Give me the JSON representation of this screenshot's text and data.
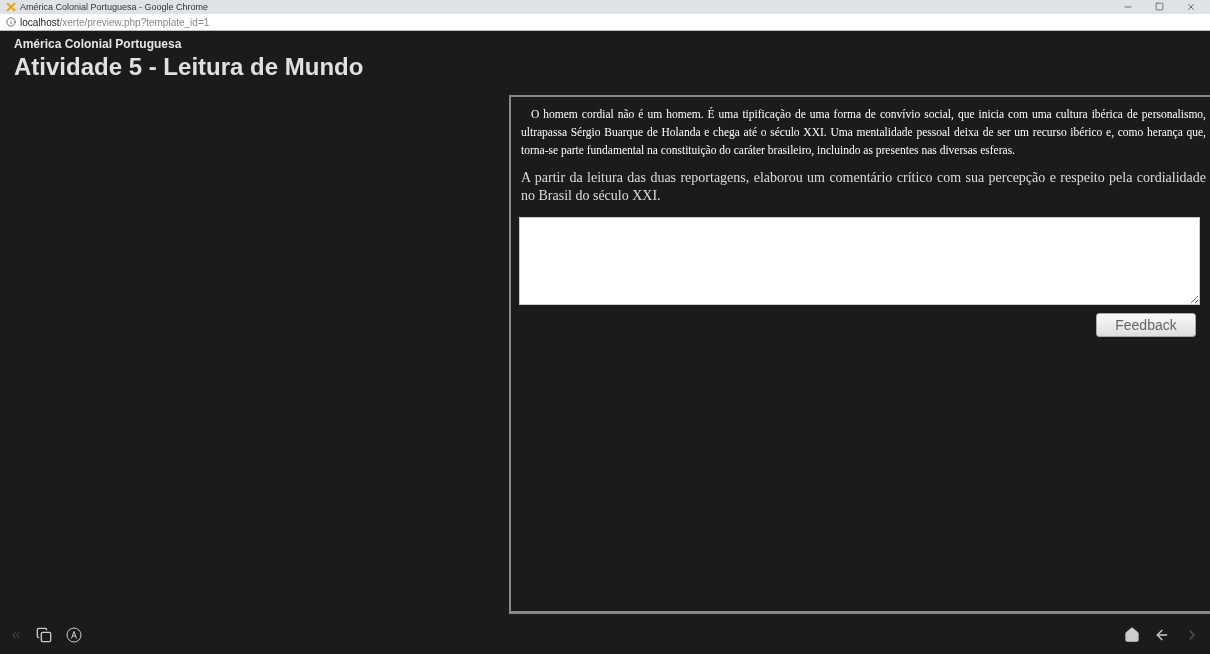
{
  "window": {
    "title": "América Colonial Portuguesa - Google Chrome"
  },
  "address_bar": {
    "host": "localhost",
    "path": "/xerte/preview.php?template_id=1"
  },
  "header": {
    "subtitle": "América Colonial Portuguesa",
    "title": "Atividade 5 - Leitura de Mundo"
  },
  "content": {
    "intro": "O homem cordial não é um homem. É uma tipificação de uma forma de convívio social, que inicia com uma cultura ibérica de personalismo, ultrapassa Sérgio Buarque de Holanda e chega até o século XXI. Uma mentalidade pessoal deixa de ser um recurso ibérico e, como herança que, torna-se parte fundamental na constituição do caráter brasileiro, incluindo as presentes nas diversas esferas.",
    "question": "A partir da leitura das duas reportagens, elaborou um comentário crítico com sua percepção e respeito pela cordialidade no Brasil do século XXI.",
    "button": "Feedback"
  },
  "footer": {
    "left": [
      {
        "kind": "collapse",
        "disabled": true
      },
      {
        "kind": "glossary",
        "disabled": false
      },
      {
        "kind": "accessibility",
        "disabled": false
      }
    ],
    "right": [
      {
        "kind": "home",
        "disabled": false
      },
      {
        "kind": "back",
        "disabled": false
      },
      {
        "kind": "next",
        "disabled": true
      }
    ]
  }
}
